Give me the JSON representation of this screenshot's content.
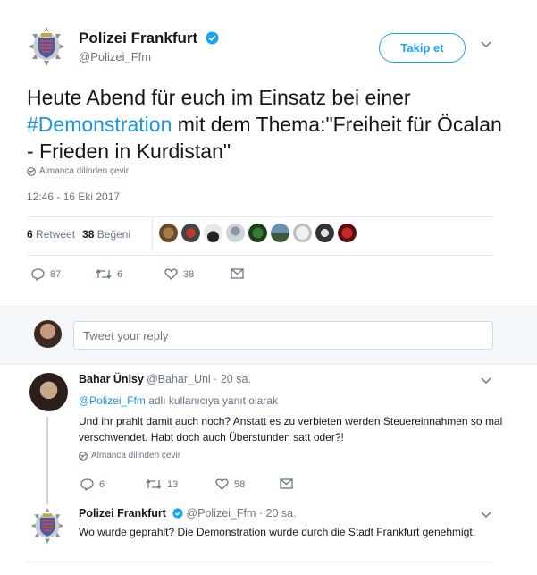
{
  "tweet": {
    "author_name": "Polizei Frankfurt",
    "author_handle": "@Polizei_Ffm",
    "follow_label": "Takip et",
    "text_before": "Heute Abend für euch im Einsatz bei einer ",
    "hashtag": "#Demonstration",
    "text_after": " mit dem Thema:\"Freiheit für Öcalan - Frieden in Kurdistan\"",
    "translate_label": "Almanca dilinden çevir",
    "timestamp": "12:46 - 16 Eki 2017",
    "retweet_count": "6",
    "retweet_label": "Retweet",
    "like_count": "38",
    "like_label": "Beğeni",
    "reply_action_count": "87",
    "retweet_action_count": "6",
    "like_action_count": "38"
  },
  "reply_box": {
    "placeholder": "Tweet your reply"
  },
  "replies": [
    {
      "author_name": "Bahar Ünlsy",
      "author_handle": "@Bahar_Unl · 20 sa.",
      "reply_to_handle": "@Polizei_Ffm",
      "reply_to_suffix": " adlı kullanıcıya yanıt olarak",
      "text": "Und ihr prahlt damit auch noch? Anstatt es zu verbieten werden Steuereinnahmen so mal verschwendet. Habt doch auch Überstunden satt oder?!",
      "translate_label": "Almanca dilinden çevir",
      "reply_count": "6",
      "retweet_count": "13",
      "like_count": "58"
    },
    {
      "author_name": "Polizei Frankfurt",
      "author_handle": "@Polizei_Ffm · 20 sa.",
      "text": "Wo wurde geprahlt? Die Demonstration wurde durch die Stadt Frankfurt genehmigt."
    }
  ],
  "colors": {
    "link": "#1b95e0",
    "follow_border": "#1da1f2",
    "text_secondary": "#657786"
  },
  "icons": [
    "police-shield-icon",
    "verified-badge-icon",
    "chevron-down-icon",
    "globe-icon",
    "reply-icon",
    "retweet-icon",
    "like-icon",
    "message-icon"
  ]
}
